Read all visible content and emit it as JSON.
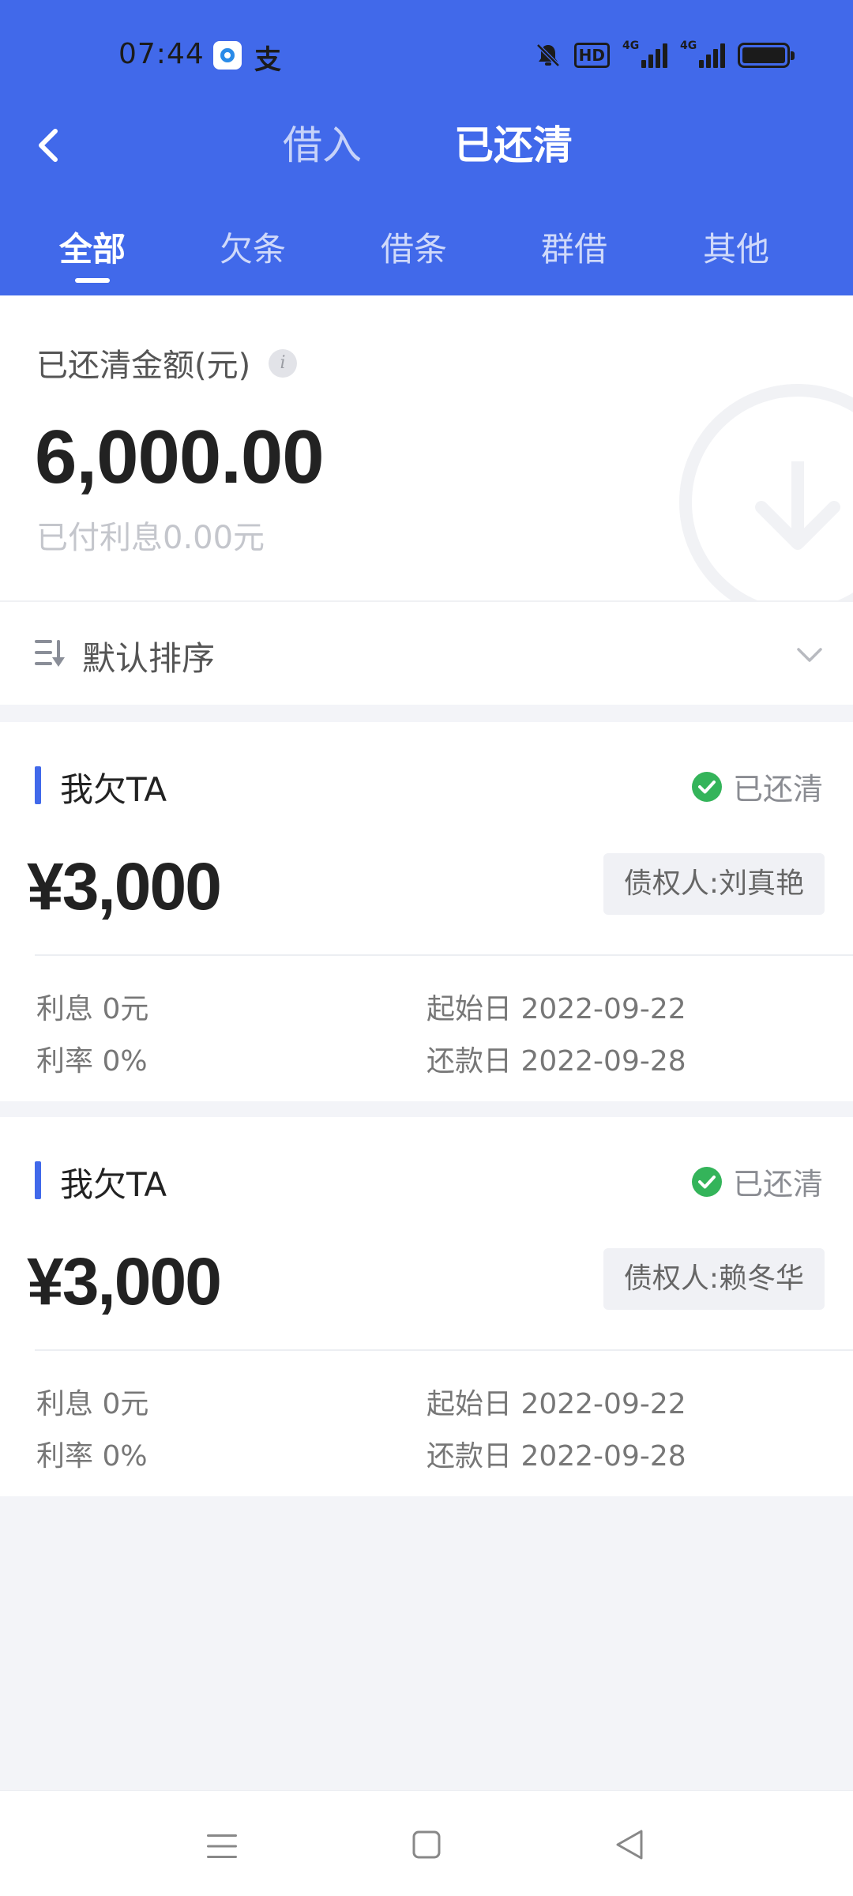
{
  "status_bar": {
    "time": "07:44",
    "hd_badge": "HD",
    "signal_1_label": "4G",
    "signal_2_label": "4G",
    "alipay_glyph": "支"
  },
  "header": {
    "back_icon": "chevron-left-icon",
    "tabs": [
      {
        "label": "借入",
        "active": false
      },
      {
        "label": "已还清",
        "active": true
      }
    ],
    "subtabs": [
      {
        "label": "全部",
        "active": true
      },
      {
        "label": "欠条",
        "active": false
      },
      {
        "label": "借条",
        "active": false
      },
      {
        "label": "群借",
        "active": false
      },
      {
        "label": "其他",
        "active": false
      }
    ],
    "accent_color": "#4169ea"
  },
  "summary": {
    "label": "已还清金额(元)",
    "info_glyph": "i",
    "amount": "6,000.00",
    "interest_paid": "已付利息0.00元"
  },
  "sort": {
    "label": "默认排序",
    "icon": "sort-icon",
    "expand_icon": "chevron-down-icon"
  },
  "records": [
    {
      "type": "我欠TA",
      "status": "已还清",
      "status_color": "#34b45a",
      "amount": "¥3,000",
      "creditor": "债权人:刘真艳",
      "interest": "利息 0元",
      "rate": "利率 0%",
      "start_date": "起始日 2022-09-22",
      "due_date": "还款日 2022-09-28"
    },
    {
      "type": "我欠TA",
      "status": "已还清",
      "status_color": "#34b45a",
      "amount": "¥3,000",
      "creditor": "债权人:赖冬华",
      "interest": "利息 0元",
      "rate": "利率 0%",
      "start_date": "起始日 2022-09-22",
      "due_date": "还款日 2022-09-28"
    }
  ],
  "bottom_nav": {
    "items": [
      "menu-icon",
      "home-icon",
      "back-icon"
    ]
  }
}
